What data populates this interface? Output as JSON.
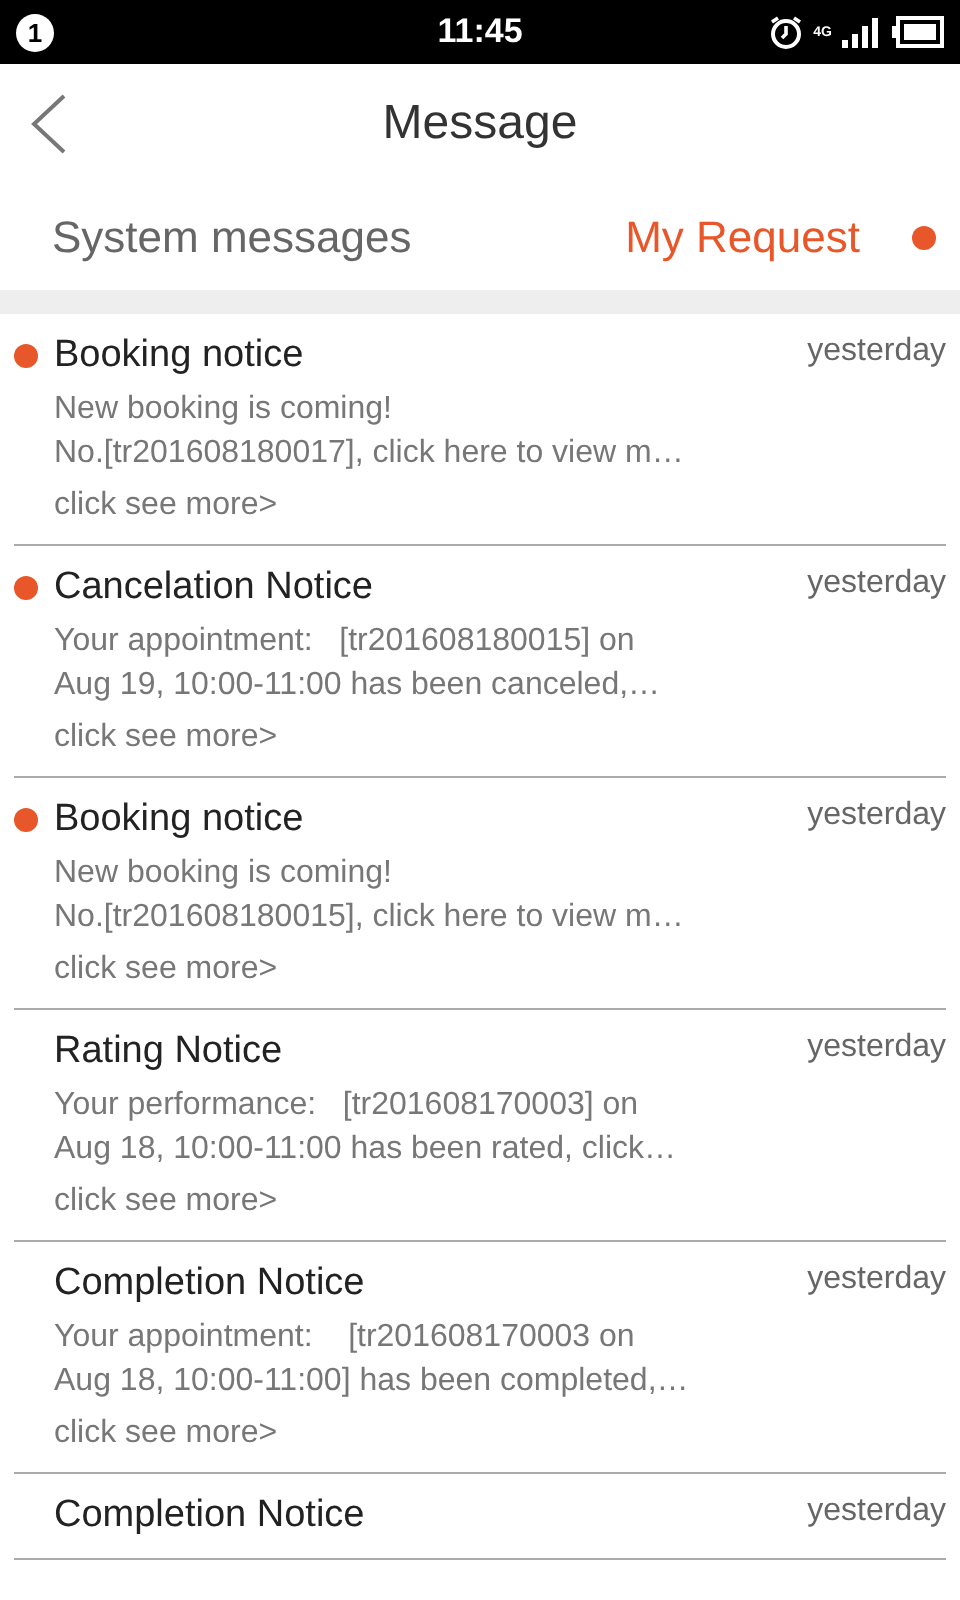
{
  "status_bar": {
    "notification_count": "1",
    "time": "11:45",
    "network": "4G"
  },
  "header": {
    "title": "Message"
  },
  "tabs": [
    {
      "label": "System messages",
      "selected": false,
      "has_new": false
    },
    {
      "label": "My Request",
      "selected": true,
      "has_new": true
    }
  ],
  "messages": [
    {
      "title": "Booking notice",
      "time": "yesterday",
      "unread": true,
      "body": [
        "New booking is coming!",
        "No.[tr201608180017], click here to view m…"
      ],
      "more": "click see more>"
    },
    {
      "title": "Cancelation Notice",
      "time": "yesterday",
      "unread": true,
      "body": [
        "Your appointment:   [tr201608180015] on",
        "Aug 19, 10:00-11:00 has been canceled,…"
      ],
      "more": "click see more>"
    },
    {
      "title": "Booking notice",
      "time": "yesterday",
      "unread": true,
      "body": [
        "New booking is coming!",
        "No.[tr201608180015], click here to view m…"
      ],
      "more": "click see more>"
    },
    {
      "title": "Rating Notice",
      "time": "yesterday",
      "unread": false,
      "body": [
        "Your performance:   [tr201608170003] on",
        "Aug 18, 10:00-11:00 has been rated, click…"
      ],
      "more": "click see more>"
    },
    {
      "title": "Completion Notice",
      "time": "yesterday",
      "unread": false,
      "body": [
        "Your appointment:    [tr201608170003 on",
        "Aug 18, 10:00-11:00] has been completed,…"
      ],
      "more": "click see more>"
    },
    {
      "title": "Completion Notice",
      "time": "yesterday",
      "unread": false
    }
  ]
}
